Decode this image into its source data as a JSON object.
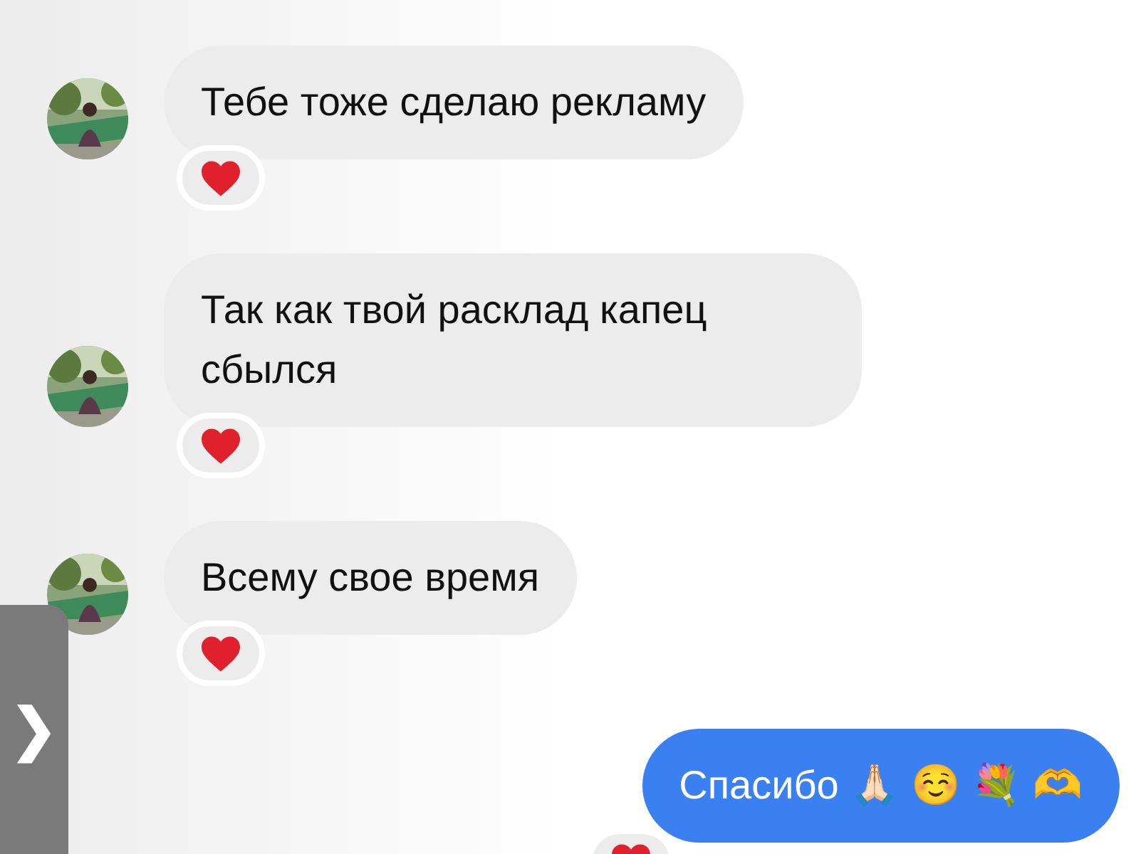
{
  "messages": [
    {
      "text": "Тебе тоже сделаю рекламу",
      "outgoing": false,
      "reaction": true
    },
    {
      "text": "Так как твой расклад капец сбылся",
      "outgoing": false,
      "reaction": true
    },
    {
      "text": "Всему свое время",
      "outgoing": false,
      "reaction": true
    },
    {
      "text": "Спасибо 🙏🏻 ☺️ 💐 🫶",
      "outgoing": true,
      "reaction": true
    }
  ],
  "side_tab": {
    "icon": "❯"
  }
}
